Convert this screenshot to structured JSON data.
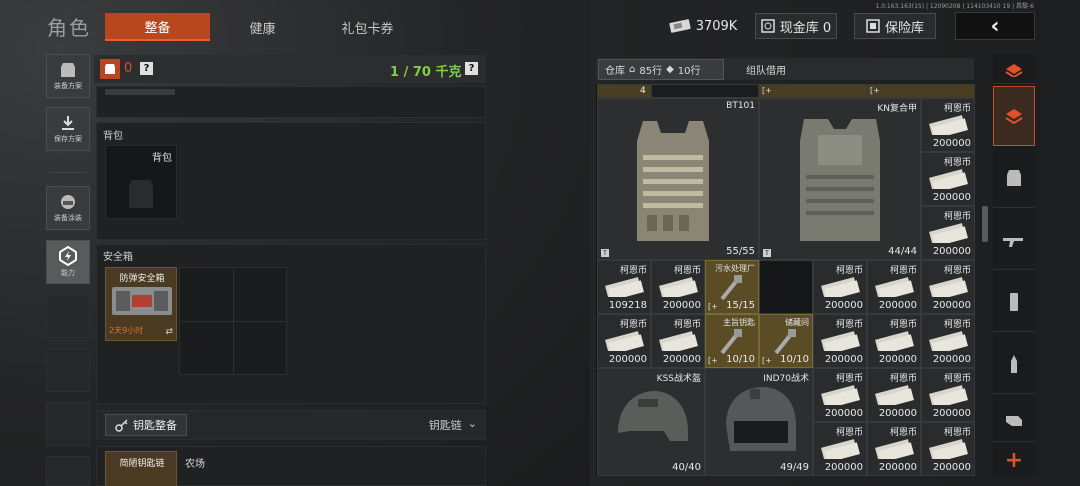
{
  "version": "1.0.163.163(15) | 12090208 | 114103410 19 | 昌黎-6",
  "header": {
    "title": "角色",
    "tabs": [
      {
        "label": "整备",
        "active": true
      },
      {
        "label": "健康",
        "active": false
      },
      {
        "label": "礼包卡券",
        "active": false
      }
    ],
    "currency_value": "3709K",
    "cash_vault_label": "现金库 0",
    "insurance_label": "保险库"
  },
  "sidebar": {
    "items": [
      {
        "label": "装备方案"
      },
      {
        "label": "保存方案"
      },
      {
        "label": "装备涂装"
      },
      {
        "label": "能力"
      }
    ]
  },
  "loadout": {
    "armor_count": "0",
    "weight": "1 / 70 千克",
    "backpack_section": "背包",
    "backpack_slot": "背包",
    "safebox_section": "安全箱",
    "safebox_item": "防弹安全箱",
    "safebox_timer": "2天9小时",
    "keys_button": "钥匙整备",
    "keychain_label": "钥匙链",
    "key_item": "简陋钥匙链",
    "key_location": "农场"
  },
  "warehouse": {
    "tab_label": "仓库",
    "rows_label": "85行",
    "tag_rows_label": "10行",
    "team_tab_label": "组队借用",
    "top_row_value": "4",
    "items": [
      {
        "name": "BT101",
        "value": "55/55"
      },
      {
        "name": "KN复合甲",
        "value": "44/44"
      },
      {
        "name": "柯恩币",
        "value": "200000"
      },
      {
        "name": "柯恩币",
        "value": "200000"
      },
      {
        "name": "柯恩币",
        "value": "200000"
      },
      {
        "name": "柯恩币",
        "value": "109218"
      },
      {
        "name": "柯恩币",
        "value": "200000"
      },
      {
        "name": "污水处理厂",
        "value": "15/15"
      },
      {
        "name": "柯恩币",
        "value": "200000"
      },
      {
        "name": "柯恩币",
        "value": "200000"
      },
      {
        "name": "柯恩币",
        "value": "200000"
      },
      {
        "name": "柯恩币",
        "value": "200000"
      },
      {
        "name": "柯恩币",
        "value": "200000"
      },
      {
        "name": "主旨钥匙",
        "value": "10/10"
      },
      {
        "name": "储藏间",
        "value": "10/10"
      },
      {
        "name": "柯恩币",
        "value": "200000"
      },
      {
        "name": "柯恩币",
        "value": "200000"
      },
      {
        "name": "柯恩币",
        "value": "200000"
      },
      {
        "name": "KSS战术盔",
        "value": "40/40"
      },
      {
        "name": "IND70战术",
        "value": "49/49"
      },
      {
        "name": "柯恩币",
        "value": "200000"
      },
      {
        "name": "柯恩币",
        "value": "200000"
      },
      {
        "name": "柯恩币",
        "value": "200000"
      },
      {
        "name": "柯恩币",
        "value": "200000"
      },
      {
        "name": "柯恩币",
        "value": "200000"
      },
      {
        "name": "柯恩币",
        "value": "200000"
      }
    ]
  },
  "colors": {
    "accent": "#b8461f",
    "weight_green": "#7ed04a",
    "key_yellow": "#5a4c25"
  }
}
